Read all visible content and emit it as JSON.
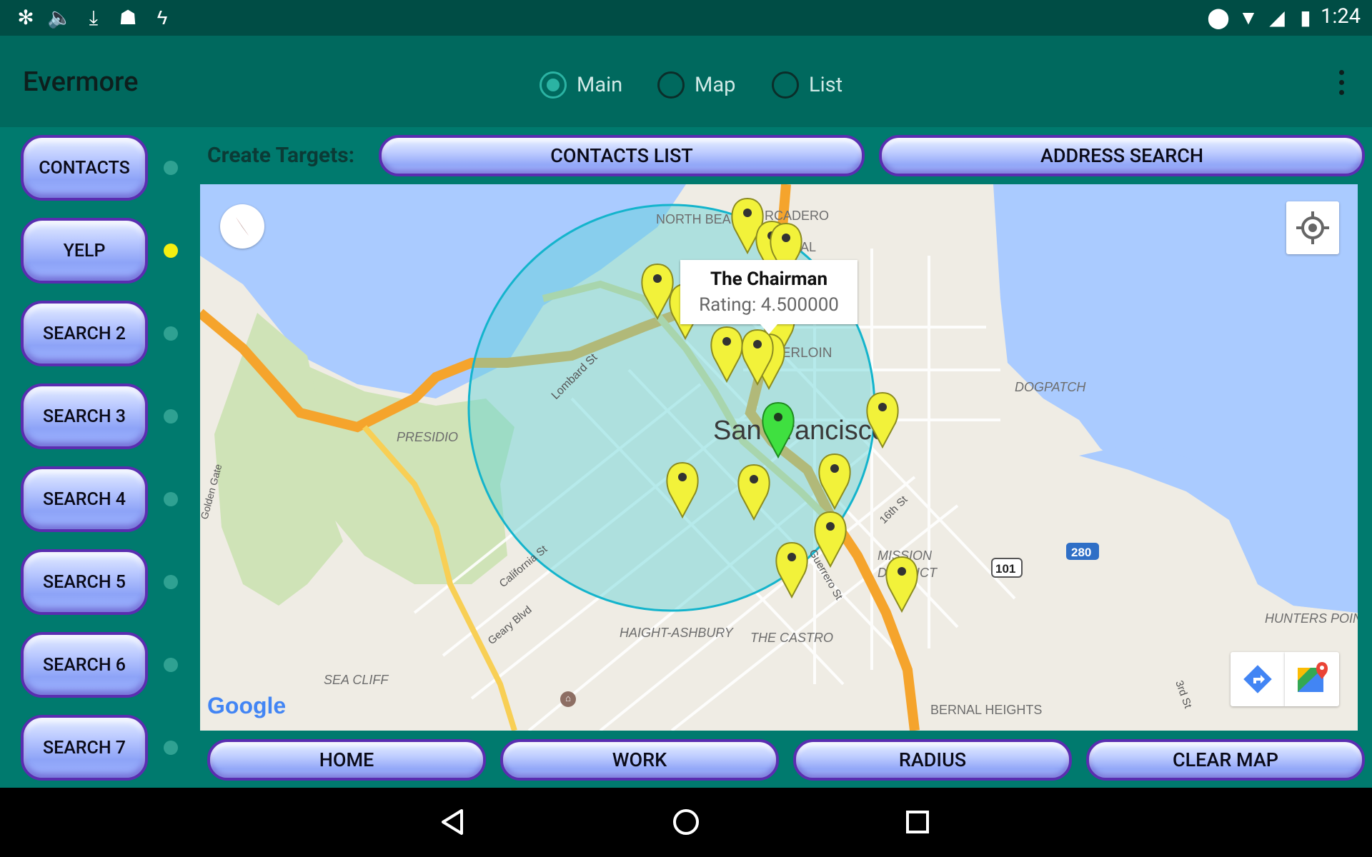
{
  "status_bar": {
    "time": "1:24"
  },
  "app": {
    "title": "Evermore"
  },
  "view_radios": [
    {
      "label": "Main",
      "selected": true
    },
    {
      "label": "Map",
      "selected": false
    },
    {
      "label": "List",
      "selected": false
    }
  ],
  "side_buttons": [
    {
      "label": "CONTACTS",
      "active": false
    },
    {
      "label": "YELP",
      "active": true
    },
    {
      "label": "SEARCH 2",
      "active": false
    },
    {
      "label": "SEARCH 3",
      "active": false
    },
    {
      "label": "SEARCH 4",
      "active": false
    },
    {
      "label": "SEARCH 5",
      "active": false
    },
    {
      "label": "SEARCH 6",
      "active": false
    },
    {
      "label": "SEARCH 7",
      "active": false
    }
  ],
  "create_targets": {
    "label": "Create Targets:",
    "contacts_list": "CONTACTS LIST",
    "address_search": "ADDRESS SEARCH"
  },
  "map": {
    "popup": {
      "title": "The Chairman",
      "subtitle": "Rating: 4.500000"
    },
    "labels": {
      "north_beach": "NORTH BEACH",
      "embarcadero": "RCADERO",
      "financial": "ANCIAL",
      "lombard": "Lombard St",
      "tenderloin": "TENDERLOIN",
      "city": "San Francisco",
      "dogpatch": "DOGPATCH",
      "presidio": "PRESIDIO",
      "golden_gate": "Golden Gate",
      "california": "California St",
      "geary": "Geary Blvd",
      "sixteenth": "16th St",
      "guerrero": "Guerrero St",
      "mission": "MISSION",
      "district": "DISTRICT",
      "haight": "HAIGHT-ASHBURY",
      "castro": "THE CASTRO",
      "sea_cliff": "SEA CLIFF",
      "bernal": "BERNAL HEIGHTS",
      "hunters": "HUNTERS POINT",
      "third": "3rd St",
      "i280": "280",
      "us101": "101",
      "google": "Google"
    },
    "colors": {
      "marker": "#f2f23a",
      "selected_marker": "#3fe040",
      "radius_fill": "#5fd3d8"
    }
  },
  "bottom_buttons": {
    "home": "HOME",
    "work": "WORK",
    "radius": "RADIUS",
    "clear": "CLEAR MAP"
  }
}
